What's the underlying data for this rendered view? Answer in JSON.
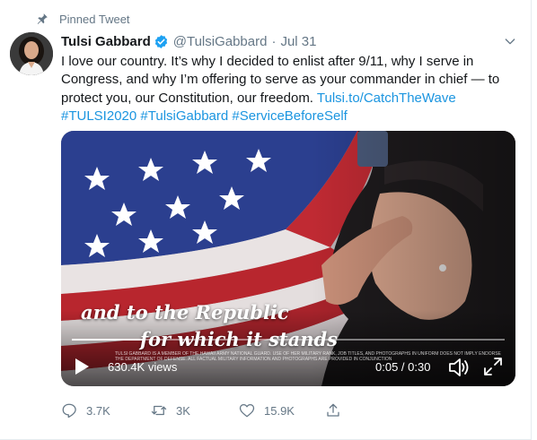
{
  "pinned": {
    "label": "Pinned Tweet",
    "icon": "pin-icon"
  },
  "author": {
    "name": "Tulsi Gabbard",
    "handle": "@TulsiGabbard",
    "separator": "·",
    "date": "Jul 31",
    "verified_icon": "verified-badge-icon"
  },
  "tweet": {
    "text": "I love our country. It’s why I decided to enlist after 9/11, why I serve in Congress, and why I’m offering to serve as your commander in chief — to protect you, our Constitution, our freedom.",
    "link": "Tulsi.to/CatchTheWave",
    "hashtags": [
      "#TULSI2020",
      "#TulsiGabbard",
      "#ServiceBeforeSelf"
    ]
  },
  "video": {
    "caption_line1": "and to the Republic",
    "caption_line2": "for which it stands",
    "fineprint_line1": "TULSI GABBARD IS A MEMBER OF THE HAWAII ARMY NATIONAL GUARD. USE OF HER MILITARY RANK, JOB TITLES, AND PHOTOGRAPHS IN UNIFORM DOES NOT IMPLY ENDORSEMENT OF THE HAWAII ARMY NATIONAL GUARD",
    "fineprint_line2": "THE DEPARTMENT OF DEFENSE. ALL FACTUAL MILITARY INFORMATION AND PHOTOGRAPHS ARE PROVIDED IN CONJUNCTION",
    "views": "630.4K views",
    "time": "0:05 / 0:30",
    "progress": 0.17
  },
  "actions": {
    "replies": "3.7K",
    "retweets": "3K",
    "likes": "15.9K"
  },
  "colors": {
    "link": "#1b95e0",
    "secondary_text": "#657786",
    "verified": "#1da1f2"
  }
}
